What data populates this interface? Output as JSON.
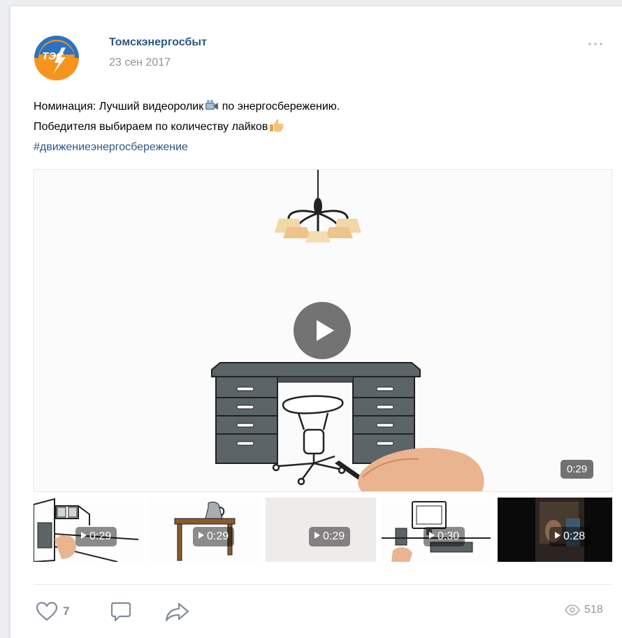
{
  "post": {
    "author": "Томскэнергосбыт",
    "date": "23 сен 2017",
    "avatar_text": "ТЭС",
    "text_line1_a": "Номинация: Лучший видеоролик",
    "text_line1_b": " по энергосбережению.",
    "text_line2": "Победителя выбираем по количеству лайков",
    "hashtag": "#движениеэнергосбережение",
    "main_video": {
      "duration": "0:29"
    },
    "thumbnails": [
      {
        "duration": "0:29"
      },
      {
        "duration": "0:29"
      },
      {
        "duration": "0:29"
      },
      {
        "duration": "0:30"
      },
      {
        "duration": "0:28"
      }
    ],
    "likes": "7",
    "views": "518"
  },
  "colors": {
    "link": "#2a5885",
    "muted": "#939393",
    "icon": "#828a99",
    "avatar_blue": "#2b73c2",
    "avatar_orange": "#f7941d",
    "desk": "#5b6467"
  },
  "icons": [
    "more-icon",
    "video-camera-emoji",
    "thumbs-up-emoji",
    "play-icon",
    "heart-icon",
    "comment-icon",
    "share-icon",
    "eye-icon"
  ]
}
